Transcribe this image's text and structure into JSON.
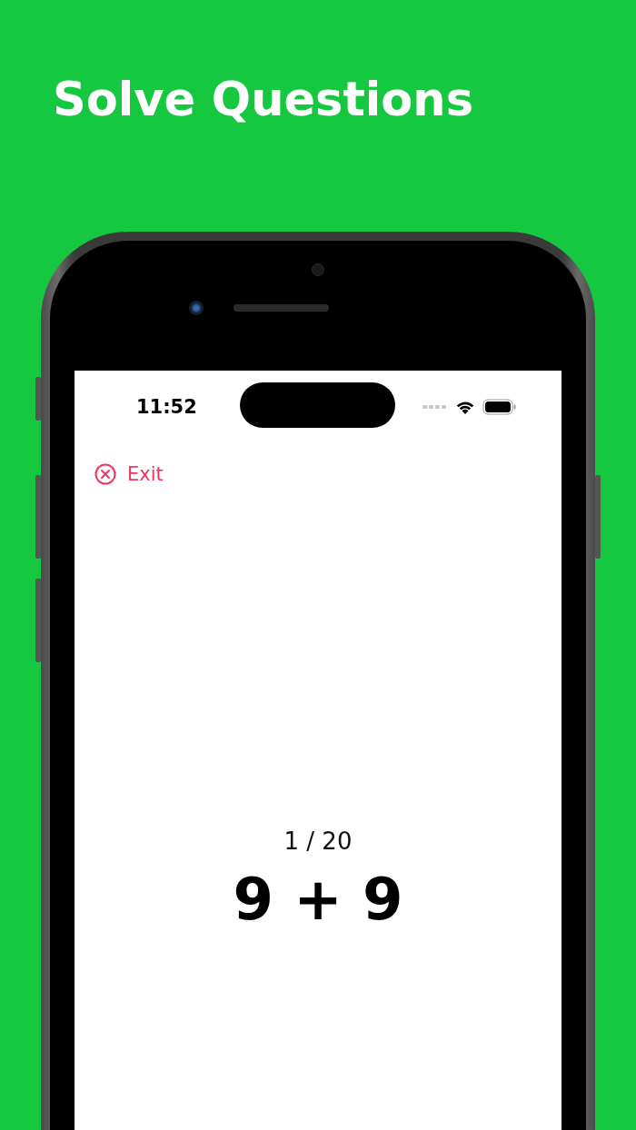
{
  "headline": "Solve Questions",
  "status_bar": {
    "time": "11:52"
  },
  "exit_button": {
    "label": "Exit"
  },
  "progress": "1 / 20",
  "question": "9 + 9"
}
